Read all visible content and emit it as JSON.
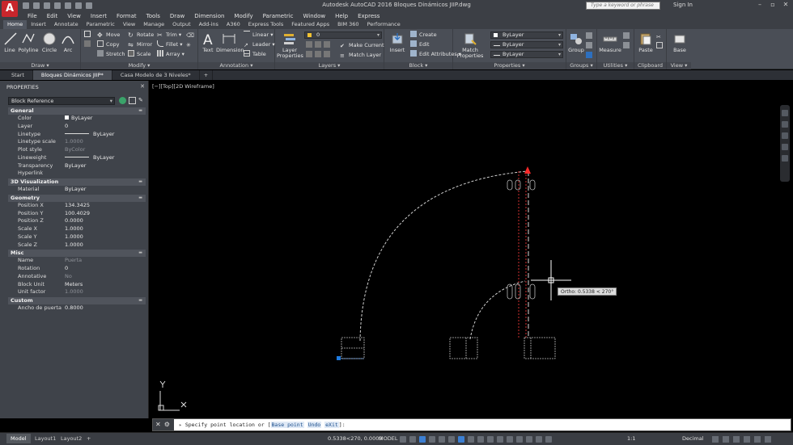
{
  "app": {
    "logo_letter": "A",
    "title": "Autodesk AutoCAD 2016   Bloques Dinámicos JIIP.dwg",
    "search_placeholder": "Type a keyword or phrase",
    "signin": "Sign In"
  },
  "menu": [
    "File",
    "Edit",
    "View",
    "Insert",
    "Format",
    "Tools",
    "Draw",
    "Dimension",
    "Modify",
    "Parametric",
    "Window",
    "Help",
    "Express"
  ],
  "ribbon_tabs": [
    "Home",
    "Insert",
    "Annotate",
    "Parametric",
    "View",
    "Manage",
    "Output",
    "Add-ins",
    "A360",
    "Express Tools",
    "Featured Apps",
    "BIM 360",
    "Performance"
  ],
  "ribbon": {
    "draw": {
      "label": "Draw ▾",
      "line": "Line",
      "polyline": "Polyline",
      "circle": "Circle",
      "arc": "Arc"
    },
    "modify": {
      "label": "Modify ▾",
      "move": "Move",
      "copy": "Copy",
      "stretch": "Stretch",
      "rotate": "Rotate",
      "mirror": "Mirror",
      "scale": "Scale",
      "trim": "Trim ▾",
      "fillet": "Fillet ▾",
      "array": "Array ▾"
    },
    "annotation": {
      "label": "Annotation ▾",
      "text": "Text",
      "dimension": "Dimension",
      "linear": "Linear ▾",
      "leader": "Leader ▾",
      "table": "Table"
    },
    "layers": {
      "label": "Layers ▾",
      "layer_properties": "Layer Properties",
      "layer_value": "0",
      "make_current": "Make Current",
      "match_layer": "Match Layer"
    },
    "block": {
      "label": "Block ▾",
      "insert": "Insert",
      "create": "Create",
      "edit": "Edit",
      "edit_attributes": "Edit Attributes ▾"
    },
    "properties": {
      "label": "Properties ▾",
      "match_properties": "Match Properties",
      "color": "ByLayer",
      "lineweight": "ByLayer",
      "linetype": "ByLayer"
    },
    "groups": {
      "label": "Groups ▾",
      "group": "Group"
    },
    "utilities": {
      "label": "Utilities ▾",
      "measure": "Measure"
    },
    "clipboard": {
      "label": "Clipboard",
      "paste": "Paste"
    },
    "view": {
      "label": "View ▾",
      "base": "Base"
    }
  },
  "doc_tabs": [
    "Start",
    "Bloques Dinámicos JIIP*",
    "Casa Modelo de 3 Niveles*"
  ],
  "properties_palette": {
    "title": "PROPERTIES",
    "object_type": "Block Reference",
    "sections": [
      {
        "name": "General",
        "rows": [
          {
            "k": "Color",
            "v": "ByLayer"
          },
          {
            "k": "Layer",
            "v": "0"
          },
          {
            "k": "Linetype",
            "v": "ByLayer"
          },
          {
            "k": "Linetype scale",
            "v": "1.0000"
          },
          {
            "k": "Plot style",
            "v": "ByColor"
          },
          {
            "k": "Lineweight",
            "v": "ByLayer"
          },
          {
            "k": "Transparency",
            "v": "ByLayer"
          },
          {
            "k": "Hyperlink",
            "v": ""
          }
        ]
      },
      {
        "name": "3D Visualization",
        "rows": [
          {
            "k": "Material",
            "v": "ByLayer"
          }
        ]
      },
      {
        "name": "Geometry",
        "rows": [
          {
            "k": "Position X",
            "v": "134.3425"
          },
          {
            "k": "Position Y",
            "v": "100.4029"
          },
          {
            "k": "Position Z",
            "v": "0.0000"
          },
          {
            "k": "Scale X",
            "v": "1.0000"
          },
          {
            "k": "Scale Y",
            "v": "1.0000"
          },
          {
            "k": "Scale Z",
            "v": "1.0000"
          }
        ]
      },
      {
        "name": "Misc",
        "rows": [
          {
            "k": "Name",
            "v": "Puerta"
          },
          {
            "k": "Rotation",
            "v": "0"
          },
          {
            "k": "Annotative",
            "v": "No"
          },
          {
            "k": "Block Unit",
            "v": "Meters"
          },
          {
            "k": "Unit factor",
            "v": "1.0000"
          }
        ]
      },
      {
        "name": "Custom",
        "rows": [
          {
            "k": "Ancho de puerta",
            "v": "0.8000"
          }
        ]
      }
    ]
  },
  "viewport_label": "[−][Top][2D Wireframe]",
  "ortho_tooltip": "Ortho: 0.5338 < 270°",
  "ucs": {
    "x": "X",
    "y": "Y"
  },
  "command": {
    "prompt": "Specify point location or [",
    "options": [
      "Base point",
      "Undo",
      "eXit"
    ],
    "suffix": "]:"
  },
  "status": {
    "layouts": [
      "Model",
      "Layout1",
      "Layout2"
    ],
    "coords": "0.5338<270, 0.0000",
    "model": "MODEL",
    "scale": "1:1",
    "units": "Decimal"
  },
  "colors": {
    "accent_red": "#c8262c",
    "selection_blue": "#1e7be0",
    "grip_red": "#ff2a2a"
  }
}
